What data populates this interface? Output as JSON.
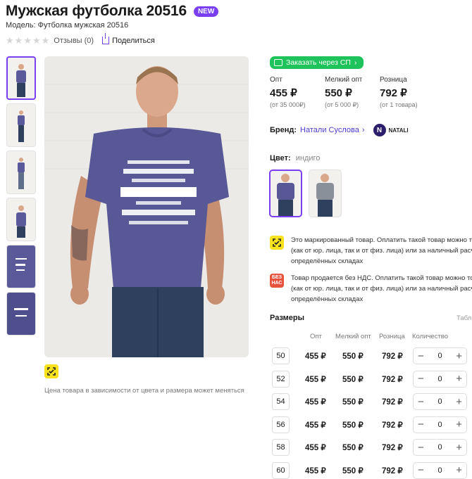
{
  "product": {
    "title": "Мужская футболка 20516",
    "badge": "NEW",
    "model": "Модель: Футболка мужская 20516"
  },
  "rating": {
    "reviews": "Отзывы (0)",
    "share": "Поделиться",
    "stars": 0
  },
  "order_button": "Заказать через СП",
  "prices": [
    {
      "label": "Опт",
      "value": "455 ₽",
      "sub": "(от 35 000₽)"
    },
    {
      "label": "Мелкий опт",
      "value": "550 ₽",
      "sub": "(от 5 000 ₽)"
    },
    {
      "label": "Розница",
      "value": "792 ₽",
      "sub": "(от 1 товара)"
    }
  ],
  "brand": {
    "label": "Бренд:",
    "name": "Натали Суслова",
    "logo_letter": "N",
    "logo_text": "NATALI"
  },
  "color": {
    "label": "Цвет:",
    "value": "индиго"
  },
  "notices": [
    {
      "icon": "marking-icon",
      "text1": "Это маркированный товар. Оплатить такой товар можно тол",
      "text2": "(как от юр. лица, так и от физ. лица) или за наличный расчё",
      "text3": "определённых складах"
    },
    {
      "icon": "no-vat-icon",
      "icon_text": "БЕЗ НАС",
      "text1": "Товар продается без НДС. Оплатить такой товар можно тол",
      "text2": "(как от юр. лица, так и от физ. лица) или за наличный расчё",
      "text3": "определённых складах"
    }
  ],
  "price_note": "Цена товара в зависимости от цвета и размера может меняться",
  "sizes": {
    "title": "Размеры",
    "table_link": "Табли",
    "columns": [
      "Опт",
      "Мелкий опт",
      "Розница",
      "Количество"
    ],
    "rows": [
      {
        "size": "50",
        "opt": "455 ₽",
        "small": "550 ₽",
        "retail": "792 ₽",
        "qty": "0"
      },
      {
        "size": "52",
        "opt": "455 ₽",
        "small": "550 ₽",
        "retail": "792 ₽",
        "qty": "0"
      },
      {
        "size": "54",
        "opt": "455 ₽",
        "small": "550 ₽",
        "retail": "792 ₽",
        "qty": "0"
      },
      {
        "size": "56",
        "opt": "455 ₽",
        "small": "550 ₽",
        "retail": "792 ₽",
        "qty": "0"
      },
      {
        "size": "58",
        "opt": "455 ₽",
        "small": "550 ₽",
        "retail": "792 ₽",
        "qty": "0"
      },
      {
        "size": "60",
        "opt": "455 ₽",
        "small": "550 ₽",
        "retail": "792 ₽",
        "qty": "0"
      }
    ],
    "minus": "−",
    "plus": "+"
  },
  "colors": {
    "accent": "#7b3ff2",
    "green": "#1fc35b",
    "shirt": "#5a5a9a",
    "jeans": "#2f3f5e"
  }
}
